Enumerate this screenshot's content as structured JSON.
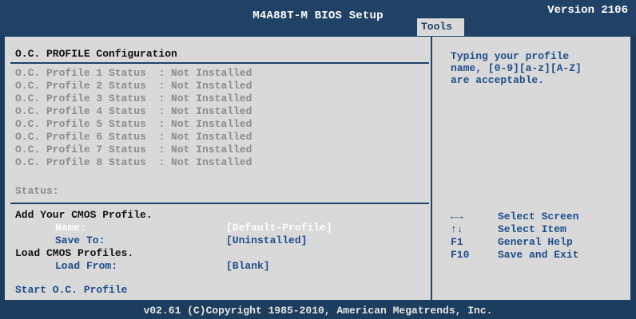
{
  "header": {
    "title": "M4A88T-M BIOS Setup",
    "version": "Version 2106",
    "active_tab": "Tools"
  },
  "main": {
    "section_title": "O.C. PROFILE Configuration",
    "profiles": [
      {
        "label": "O.C. Profile 1 Status",
        "value": ": Not Installed"
      },
      {
        "label": "O.C. Profile 2 Status",
        "value": ": Not Installed"
      },
      {
        "label": "O.C. Profile 3 Status",
        "value": ": Not Installed"
      },
      {
        "label": "O.C. Profile 4 Status",
        "value": ": Not Installed"
      },
      {
        "label": "O.C. Profile 5 Status",
        "value": ": Not Installed"
      },
      {
        "label": "O.C. Profile 6 Status",
        "value": ": Not Installed"
      },
      {
        "label": "O.C. Profile 7 Status",
        "value": ": Not Installed"
      },
      {
        "label": "O.C. Profile 8 Status",
        "value": ": Not Installed"
      }
    ],
    "status_label": "Status:",
    "add_profile_heading": "Add Your CMOS Profile.",
    "name_label": "Name:",
    "name_value": "[Default-Profile]",
    "save_to_label": "Save To:",
    "save_to_value": "[Uninstalled]",
    "load_heading": "Load CMOS Profiles.",
    "load_from_label": "Load From:",
    "load_from_value": "[Blank]",
    "start_label": "Start O.C. Profile"
  },
  "help": {
    "text": "Typing your profile\nname, [0-9][a-z][A-Z]\nare acceptable."
  },
  "keys": [
    {
      "key": "←→",
      "desc": "Select Screen"
    },
    {
      "key": "↑↓",
      "desc": "Select Item"
    },
    {
      "key": "F1",
      "desc": "General Help"
    },
    {
      "key": "F10",
      "desc": "Save and Exit"
    }
  ],
  "footer": {
    "text": "v02.61 (C)Copyright 1985-2010, American Megatrends, Inc."
  },
  "colors": {
    "background": "#1c3d5e",
    "panel": "#d9d9d9",
    "accent_text": "#1f4d8a",
    "disabled_text": "#8c8c8c",
    "highlight_text": "#ffffff"
  }
}
